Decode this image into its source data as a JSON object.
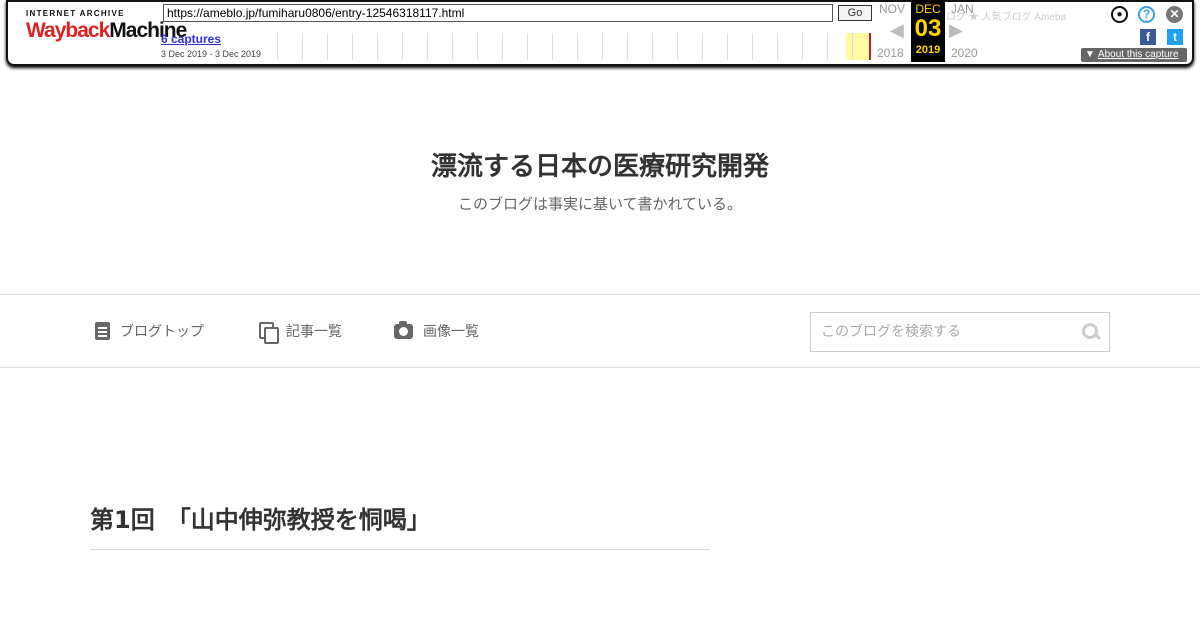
{
  "wayback": {
    "logo_top": "INTERNET ARCHIVE",
    "logo_way": "Wayback",
    "logo_machine": "Machine",
    "url": "https://ameblo.jp/fumiharu0806/entry-12546318117.html",
    "go_label": "Go",
    "captures_label": "6 captures",
    "capture_range": "3 Dec 2019 - 3 Dec 2019",
    "prev_month": "NOV",
    "prev_year": "2018",
    "current_month": "DEC",
    "current_day": "03",
    "current_year": "2019",
    "next_month": "JAN",
    "next_year": "2020",
    "about_label": "About this capture",
    "underlying_text": "ブログ   ★ 人気ブログ      Ameba"
  },
  "blog": {
    "title": "漂流する日本の医療研究開発",
    "description": "このブログは事実に基いて書かれている。"
  },
  "nav": {
    "items": [
      {
        "label": "ブログトップ",
        "icon": "document-icon"
      },
      {
        "label": "記事一覧",
        "icon": "copy-icon"
      },
      {
        "label": "画像一覧",
        "icon": "camera-icon"
      }
    ],
    "search_placeholder": "このブログを検索する"
  },
  "article": {
    "title": "第1回　「山中伸弥教授を恫喝」"
  }
}
